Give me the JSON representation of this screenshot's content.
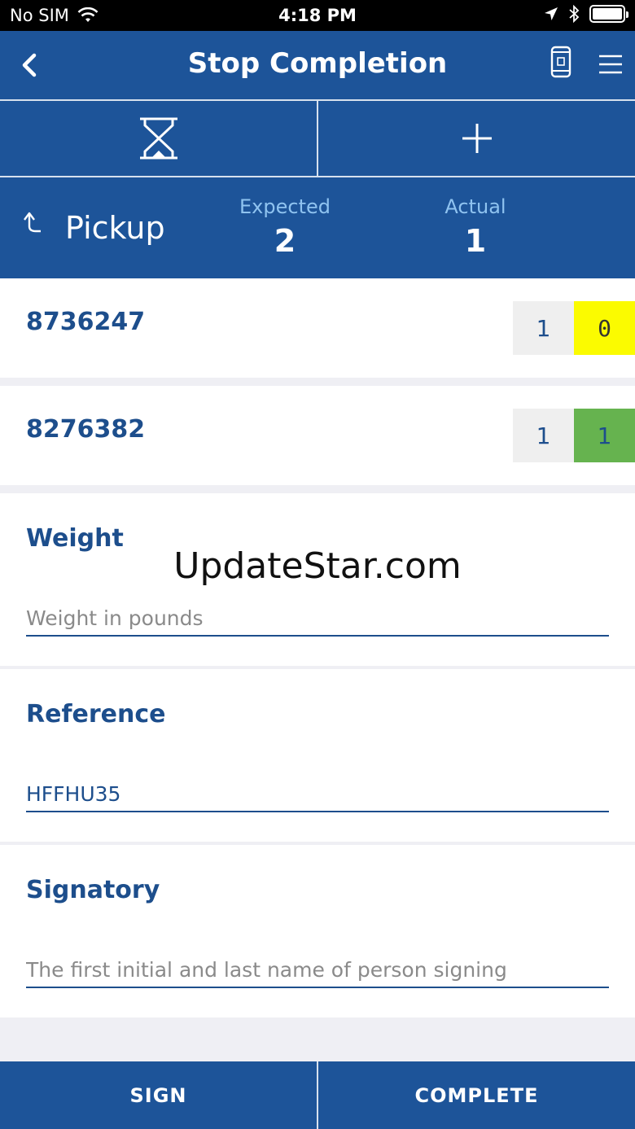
{
  "status_bar": {
    "carrier": "No SIM",
    "time": "4:18 PM"
  },
  "header": {
    "title": "Stop Completion"
  },
  "summary": {
    "type_label": "Pickup",
    "expected_label": "Expected",
    "expected_value": "2",
    "actual_label": "Actual",
    "actual_value": "1"
  },
  "items": [
    {
      "id": "8736247",
      "expected": "1",
      "actual": "0",
      "status_color": "#fbfb00"
    },
    {
      "id": "8276382",
      "expected": "1",
      "actual": "1",
      "status_color": "#66b34f"
    }
  ],
  "fields": {
    "weight": {
      "label": "Weight",
      "value": "",
      "placeholder": "Weight in pounds"
    },
    "reference": {
      "label": "Reference",
      "value": "HFFHU35",
      "placeholder": ""
    },
    "signatory": {
      "label": "Signatory",
      "value": "",
      "placeholder": "The first initial and last name of person signing"
    }
  },
  "watermark": "UpdateStar.com",
  "bottom": {
    "sign_label": "SIGN",
    "complete_label": "COMPLETE"
  },
  "colors": {
    "brand": "#1d5499",
    "text_dark_blue": "#1d4e8c"
  }
}
